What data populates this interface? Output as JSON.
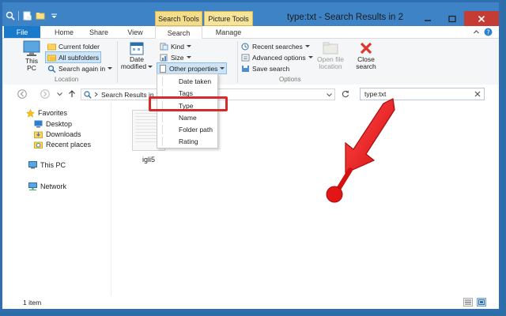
{
  "window": {
    "title": "type:txt - Search Results in 2",
    "minimize_glyph": "—",
    "maximize_glyph": "☐",
    "close_glyph": "✕"
  },
  "context_groups": {
    "search_tools": "Search Tools",
    "picture_tools": "Picture Tools"
  },
  "tabs": {
    "file": "File",
    "home": "Home",
    "share": "Share",
    "view": "View",
    "search": "Search",
    "manage": "Manage"
  },
  "ribbon": {
    "this_pc": "This PC",
    "current_folder": "Current folder",
    "all_subfolders": "All subfolders",
    "search_again_in": "Search again in",
    "location_group": "Location",
    "date_modified_line1": "Date",
    "date_modified_line2": "modified",
    "kind": "Kind",
    "size": "Size",
    "other_properties": "Other properties",
    "recent_searches": "Recent searches",
    "advanced_options": "Advanced options",
    "save_search": "Save search",
    "options_group": "Options",
    "open_file_location_line1": "Open file",
    "open_file_location_line2": "location",
    "close_search_line1": "Close",
    "close_search_line2": "search"
  },
  "dropdown_items": {
    "date_taken": "Date taken",
    "tags": "Tags",
    "type": "Type",
    "name": "Name",
    "folder_path": "Folder path",
    "rating": "Rating"
  },
  "address": {
    "path": "Search Results in",
    "search_value": "type:txt"
  },
  "navpane": {
    "favorites": "Favorites",
    "desktop": "Desktop",
    "downloads": "Downloads",
    "recent_places": "Recent places",
    "this_pc": "This PC",
    "network": "Network"
  },
  "files": [
    {
      "name": "igli5"
    }
  ],
  "status": {
    "item_count": "1 item"
  },
  "colors": {
    "title_bar": "#3d83c6",
    "file_tab": "#1979ca",
    "search_tools": "#f3dc8a",
    "highlight_red": "#d72a2a"
  },
  "icons": {
    "minimize": "minimize-icon",
    "maximize": "maximize-icon",
    "close": "close-icon",
    "search": "search-icon",
    "back": "back-arrow-icon",
    "forward": "forward-arrow-icon",
    "up": "up-arrow-icon",
    "refresh": "refresh-icon"
  }
}
